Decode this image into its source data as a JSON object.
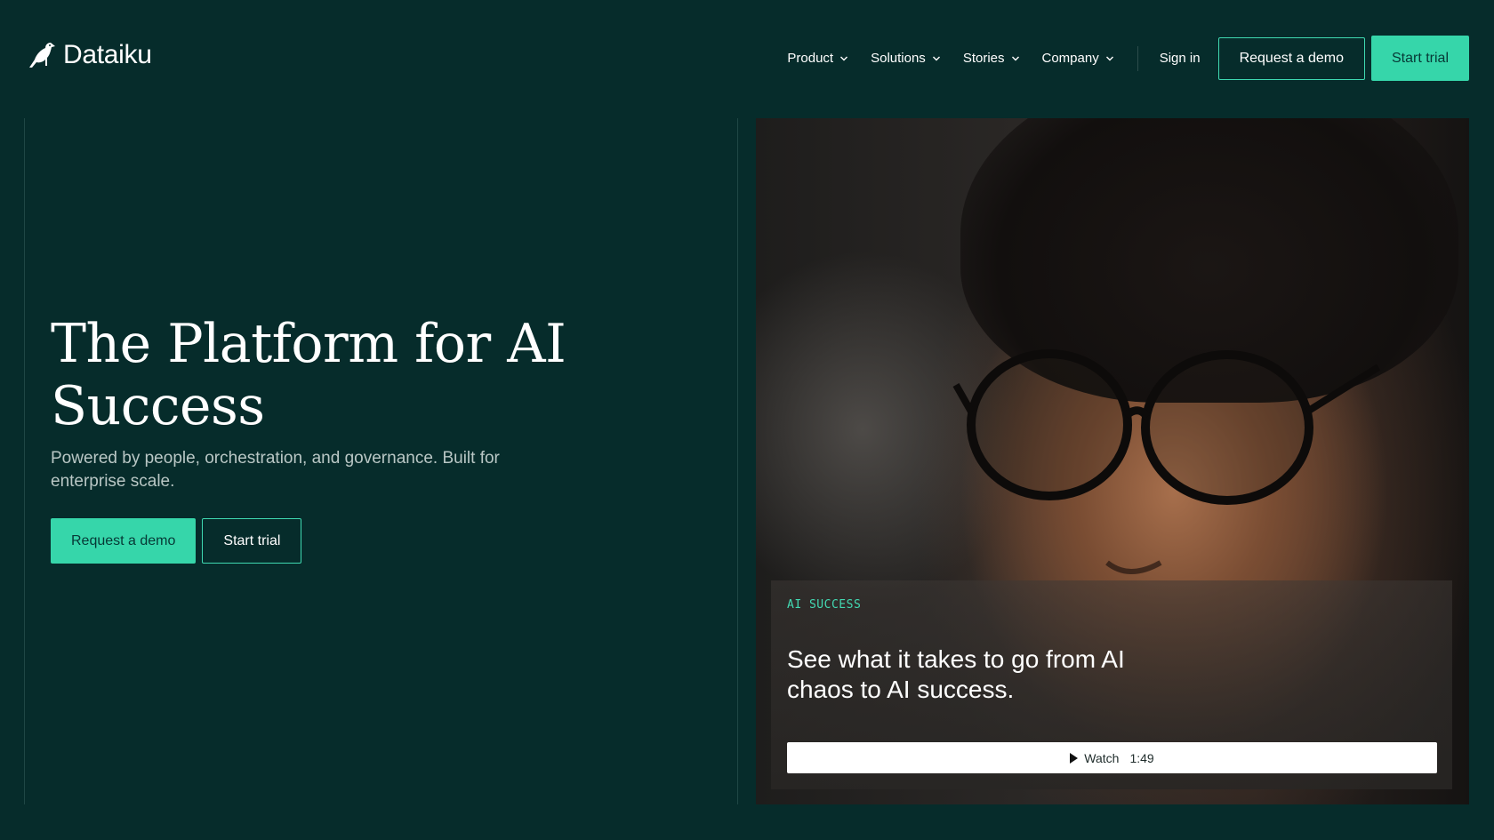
{
  "brand": {
    "name": "Dataiku"
  },
  "nav": {
    "items": [
      {
        "label": "Product"
      },
      {
        "label": "Solutions"
      },
      {
        "label": "Stories"
      },
      {
        "label": "Company"
      }
    ],
    "sign_in": "Sign in",
    "request_demo": "Request a demo",
    "start_trial": "Start trial"
  },
  "hero": {
    "title": "The Platform for AI Success",
    "subtitle": "Powered by people, orchestration, and governance. Built for enterprise scale.",
    "primary_cta": "Request a demo",
    "secondary_cta": "Start trial"
  },
  "video_card": {
    "tag": "AI SUCCESS",
    "title": "See what it takes to go from AI chaos to AI success.",
    "watch_label": "Watch",
    "duration": "1:49"
  },
  "colors": {
    "background": "#062c2b",
    "accent": "#36d6aa",
    "tag": "#43d9b2"
  },
  "icons": {
    "logo": "bird-icon",
    "dropdown": "chevron-down-icon",
    "play": "play-icon"
  }
}
